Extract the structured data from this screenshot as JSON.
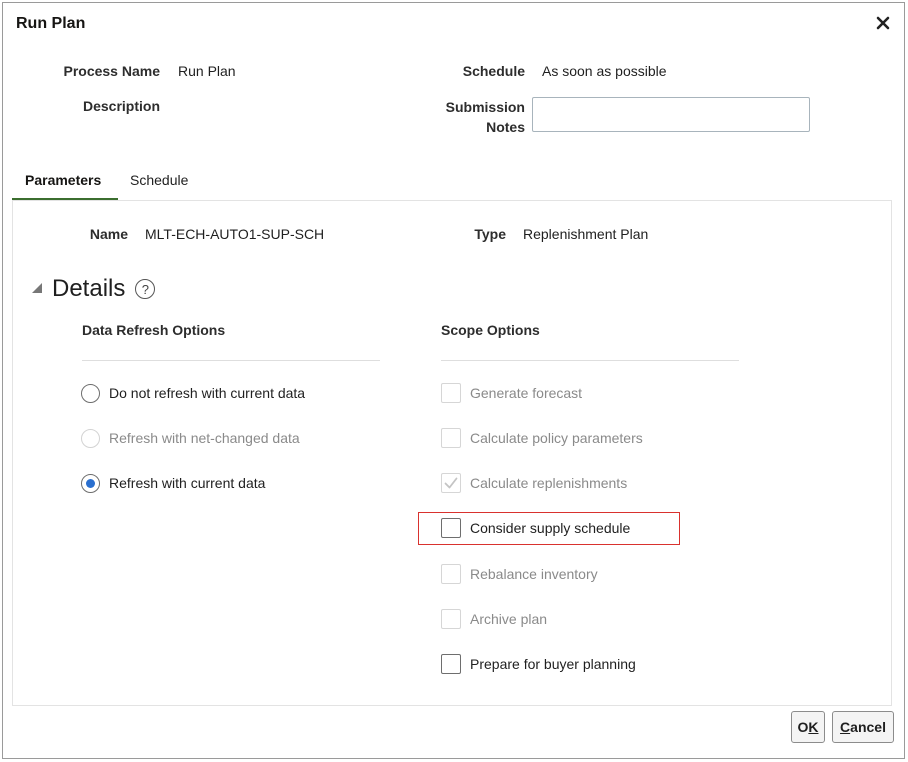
{
  "dialog": {
    "title": "Run Plan",
    "close_icon": "close-icon"
  },
  "header": {
    "process_name_label": "Process Name",
    "process_name_value": "Run Plan",
    "description_label": "Description",
    "schedule_label": "Schedule",
    "schedule_value": "As soon as possible",
    "submission_notes_label_1": "Submission",
    "submission_notes_label_2": "Notes",
    "submission_notes_value": ""
  },
  "tabs": [
    {
      "label": "Parameters",
      "active": true
    },
    {
      "label": "Schedule",
      "active": false
    }
  ],
  "parameters": {
    "name_label": "Name",
    "name_value": "MLT-ECH-AUTO1-SUP-SCH",
    "type_label": "Type",
    "type_value": "Replenishment Plan"
  },
  "details": {
    "title": "Details",
    "help_icon": "help-icon",
    "data_refresh": {
      "heading": "Data Refresh Options",
      "options": [
        {
          "label": "Do not refresh with current data",
          "checked": false,
          "disabled": false
        },
        {
          "label": "Refresh with net-changed data",
          "checked": false,
          "disabled": true
        },
        {
          "label": "Refresh with current data",
          "checked": true,
          "disabled": false
        }
      ]
    },
    "scope": {
      "heading": "Scope Options",
      "options": [
        {
          "label": "Generate forecast",
          "checked": false,
          "disabled": true
        },
        {
          "label": "Calculate policy parameters",
          "checked": false,
          "disabled": true
        },
        {
          "label": "Calculate replenishments",
          "checked": true,
          "disabled": true
        },
        {
          "label": "Consider supply schedule",
          "checked": false,
          "disabled": false,
          "highlighted": true
        },
        {
          "label": "Rebalance inventory",
          "checked": false,
          "disabled": true
        },
        {
          "label": "Archive plan",
          "checked": false,
          "disabled": true
        },
        {
          "label": "Prepare for buyer planning",
          "checked": false,
          "disabled": false
        }
      ]
    }
  },
  "footer": {
    "ok_label_mnemonic": "K",
    "ok_label_prefix": "O",
    "cancel_label_mnemonic": "C",
    "cancel_label_rest": "ancel"
  },
  "colors": {
    "tab_underline": "#3b6e2f",
    "radio_selected": "#2a6fcf",
    "highlight_border": "#d9322e"
  }
}
